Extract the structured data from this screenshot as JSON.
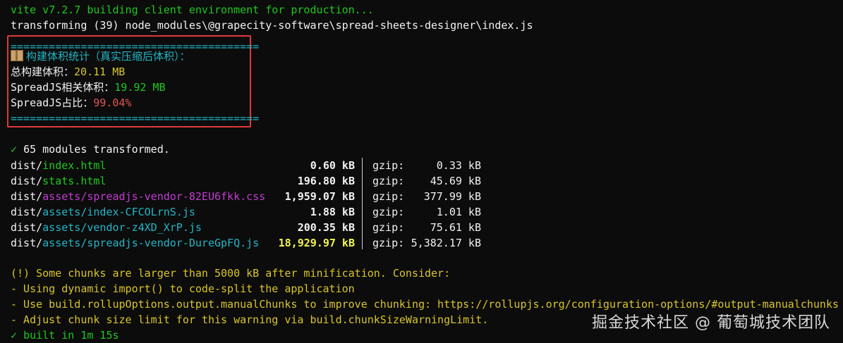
{
  "header": {
    "vite_line": "vite v7.2.7 building client environment for production...",
    "transform_line": "transforming (39) node_modules\\@grapecity-software\\spread-sheets-designer\\index.js"
  },
  "stats_box": {
    "separator": "=======================================",
    "title": "构建体积统计（真实压缩后体积）：",
    "total_label": "总构建体积：",
    "total_value": "20.11 MB",
    "spread_label": "SpreadJS相关体积：",
    "spread_value": "19.92 MB",
    "ratio_label": "SpreadJS占比：",
    "ratio_value": "99.04%"
  },
  "summary": {
    "check": "✓",
    "modules_text": "65 modules transformed."
  },
  "files": [
    {
      "prefix": "dist/",
      "name": "index.html",
      "color": "green",
      "size": "0.60 kB",
      "gzip_label": "gzip:",
      "gzip_size": "0.33 kB"
    },
    {
      "prefix": "dist/",
      "name": "stats.html",
      "color": "green",
      "size": "196.80 kB",
      "gzip_label": "gzip:",
      "gzip_size": "45.69 kB"
    },
    {
      "prefix": "dist/",
      "name": "assets/spreadjs-vendor-82EU6fkk.css",
      "color": "magenta",
      "size": "1,959.07 kB",
      "gzip_label": "gzip:",
      "gzip_size": "377.99 kB"
    },
    {
      "prefix": "dist/",
      "name": "assets/index-CFCOLrnS.js",
      "color": "cyan",
      "size": "1.88 kB",
      "gzip_label": "gzip:",
      "gzip_size": "1.01 kB"
    },
    {
      "prefix": "dist/",
      "name": "assets/vendor-z4XD_XrP.js",
      "color": "cyan",
      "size": "200.35 kB",
      "gzip_label": "gzip:",
      "gzip_size": "75.61 kB"
    },
    {
      "prefix": "dist/",
      "name": "assets/spreadjs-vendor-DureGpFQ.js",
      "color": "cyan",
      "size": "18,929.97 kB",
      "gzip_label": "gzip:",
      "gzip_size": "5,382.17 kB"
    }
  ],
  "warning": {
    "line1": "(!) Some chunks are larger than 5000 kB after minification. Consider:",
    "line2": "- Using dynamic import() to code-split the application",
    "line3": "- Use build.rollupOptions.output.manualChunks to improve chunking: https://rollupjs.org/configuration-options/#output-manualchunks",
    "line4": "- Adjust chunk size limit for this warning via build.chunkSizeWarningLimit.",
    "built_check": "✓",
    "built_text": "built in 1m 15s"
  },
  "watermark": "掘金技术社区 @ 葡萄城技术团队",
  "colors": {
    "background": "#0c0c0c",
    "green": "#1ec81e",
    "cyan": "#22b7c7",
    "yellow": "#d9c52a",
    "red": "#e05555",
    "magenta": "#c23bd2",
    "highlight_box": "#e0383c"
  }
}
